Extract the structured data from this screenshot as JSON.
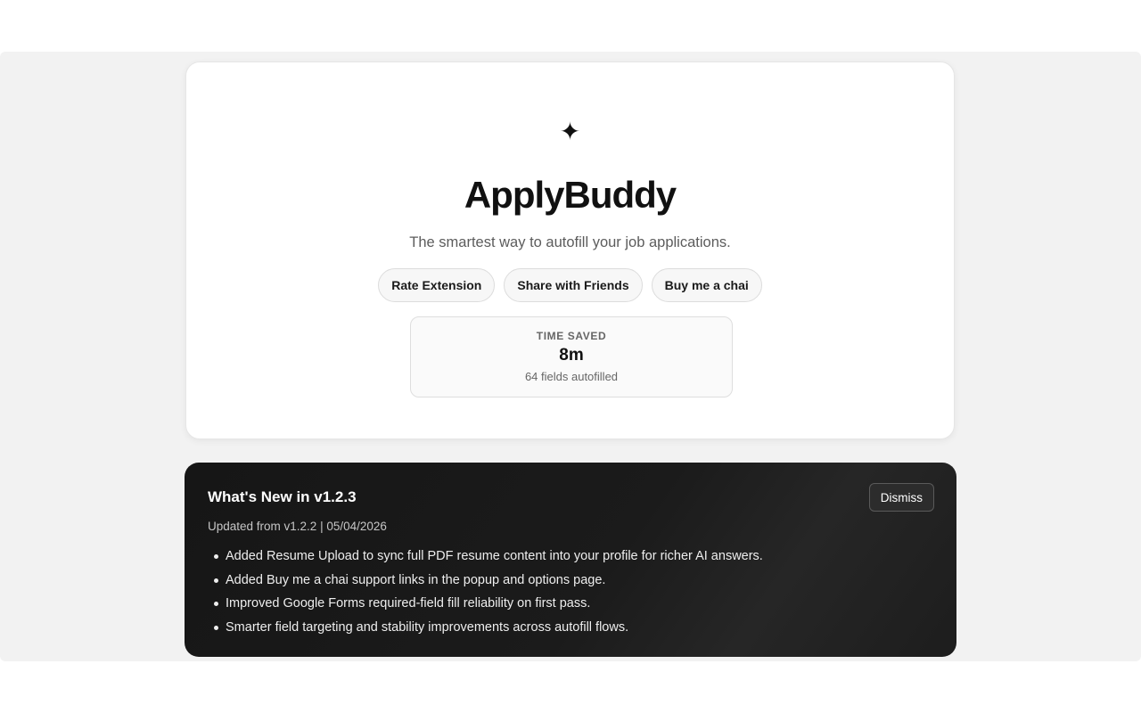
{
  "app": {
    "logo_icon": "sparkle-icon",
    "logo_glyph": "✦",
    "title": "ApplyBuddy",
    "tagline": "The smartest way to autofill your job applications."
  },
  "actions": {
    "rate_label": "Rate Extension",
    "share_label": "Share with Friends",
    "chai_label": "Buy me a chai"
  },
  "stats": {
    "label": "TIME SAVED",
    "value": "8m",
    "sub": "64 fields autofilled"
  },
  "whats_new": {
    "title": "What's New in v1.2.3",
    "dismiss_label": "Dismiss",
    "meta": "Updated from v1.2.2 | 05/04/2026",
    "items": [
      "Added Resume Upload to sync full PDF resume content into your profile for richer AI answers.",
      "Added Buy me a chai support links in the popup and options page.",
      "Improved Google Forms required-field fill reliability on first pass.",
      "Smarter field targeting and stability improvements across autofill flows."
    ]
  },
  "colors": {
    "page_bg": "#f2f2f2",
    "card_bg": "#ffffff",
    "dark_card_bg": "#1b1b1b",
    "text_primary": "#111111",
    "text_muted": "#5c5c5c"
  }
}
